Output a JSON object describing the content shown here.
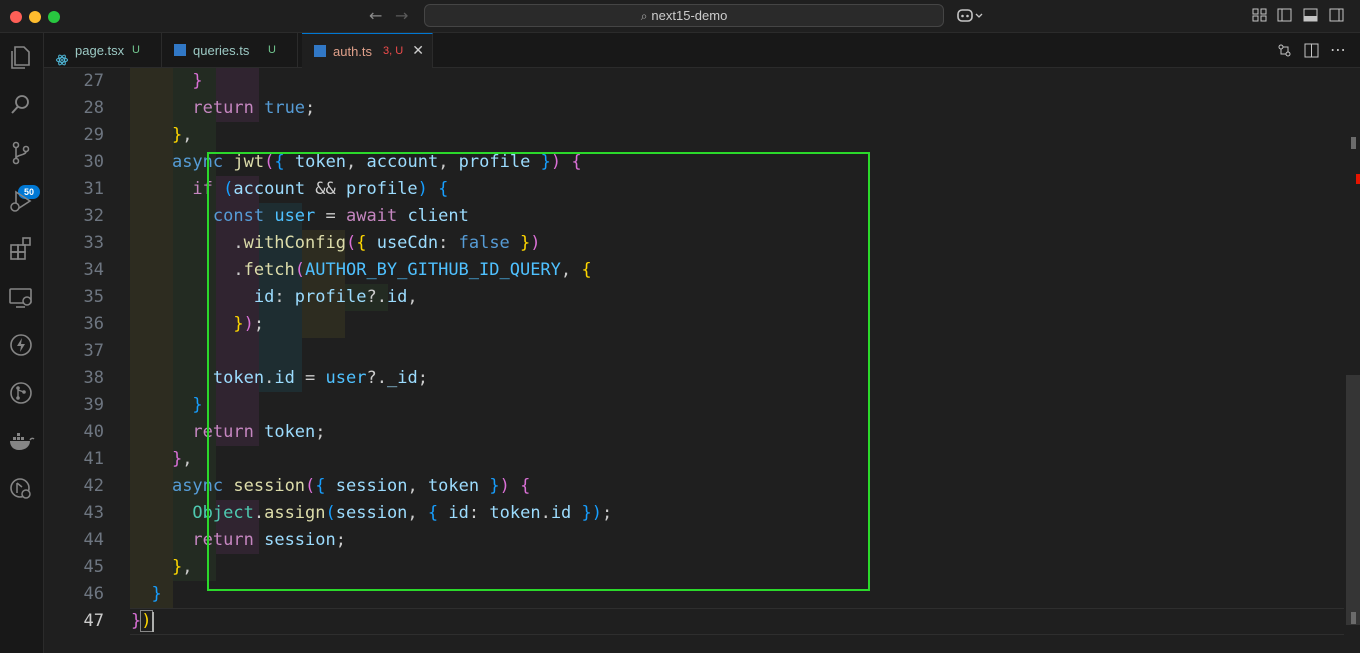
{
  "window": {
    "search_text": "next15-demo"
  },
  "activity_bar": {
    "icons": [
      "files-icon",
      "search-icon",
      "source-control-icon",
      "run-debug-icon",
      "extensions-icon",
      "remote-explorer-icon",
      "bolt-icon",
      "git-graph-icon",
      "docker-icon",
      "settings-sync-icon"
    ],
    "source_control_badge": "50"
  },
  "tabs": [
    {
      "name": "page.tsx",
      "status": "U",
      "active": false
    },
    {
      "name": "queries.ts",
      "status": "U",
      "active": false
    },
    {
      "name": "auth.ts",
      "status": "3, U",
      "active": true
    }
  ],
  "editor": {
    "current_line": "47",
    "lines": [
      {
        "num": "27",
        "text": "      }"
      },
      {
        "num": "28",
        "text": "      return true;"
      },
      {
        "num": "29",
        "text": "    },"
      },
      {
        "num": "30",
        "text": "    async jwt({ token, account, profile }) {"
      },
      {
        "num": "31",
        "text": "      if (account && profile) {"
      },
      {
        "num": "32",
        "text": "        const user = await client"
      },
      {
        "num": "33",
        "text": "          .withConfig({ useCdn: false })"
      },
      {
        "num": "34",
        "text": "          .fetch(AUTHOR_BY_GITHUB_ID_QUERY, {"
      },
      {
        "num": "35",
        "text": "            id: profile?.id,"
      },
      {
        "num": "36",
        "text": "          });"
      },
      {
        "num": "37",
        "text": ""
      },
      {
        "num": "38",
        "text": "        token.id = user?._id;"
      },
      {
        "num": "39",
        "text": "      }"
      },
      {
        "num": "40",
        "text": "      return token;"
      },
      {
        "num": "41",
        "text": "    },"
      },
      {
        "num": "42",
        "text": "    async session({ session, token }) {"
      },
      {
        "num": "43",
        "text": "      Object.assign(session, { id: token.id });"
      },
      {
        "num": "44",
        "text": "      return session;"
      },
      {
        "num": "45",
        "text": "    },"
      },
      {
        "num": "46",
        "text": "  }"
      },
      {
        "num": "47",
        "text": "})"
      }
    ]
  },
  "colors": {
    "highlight_box": "#2bd92b",
    "keyword": "#569cd6",
    "control": "#c586c0",
    "function": "#dcdcaa",
    "variable": "#9cdcfe",
    "constant": "#4fc1ff",
    "class": "#4ec9b0",
    "active_tab_text": "#e0a08a"
  }
}
